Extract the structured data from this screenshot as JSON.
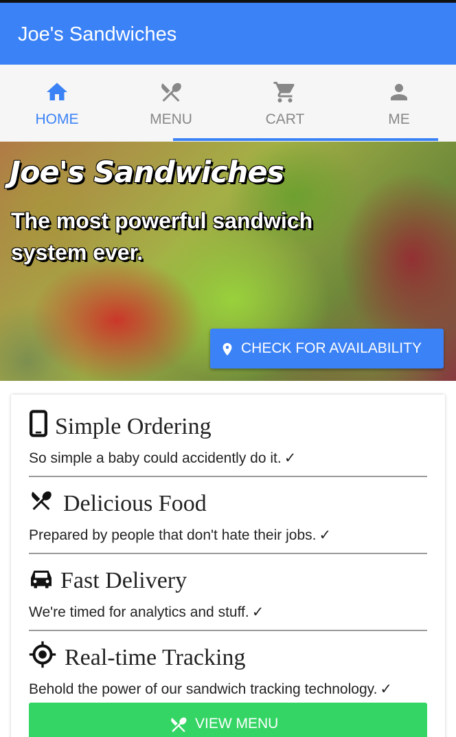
{
  "app_bar": {
    "title": "Joe's Sandwiches"
  },
  "tabs": [
    {
      "label": "HOME",
      "icon": "home-icon",
      "active": true
    },
    {
      "label": "MENU",
      "icon": "utensils-icon",
      "active": false
    },
    {
      "label": "CART",
      "icon": "cart-icon",
      "active": false
    },
    {
      "label": "ME",
      "icon": "person-icon",
      "active": false
    }
  ],
  "hero": {
    "title": "Joe's Sandwiches",
    "subtitle": "The most powerful sandwich system ever.",
    "availability_button": "CHECK FOR AVAILABILITY",
    "availability_icon": "location-pin-icon"
  },
  "features": [
    {
      "title": "Simple Ordering",
      "description": "So simple a baby could accidently do it.",
      "icon": "phone-icon"
    },
    {
      "title": "Delicious Food",
      "description": "Prepared by people that don't hate their jobs.",
      "icon": "utensils-icon"
    },
    {
      "title": "Fast Delivery",
      "description": "We're timed for analytics and stuff.",
      "icon": "car-icon"
    },
    {
      "title": "Real-time Tracking",
      "description": "Behold the power of our sandwich tracking technology.",
      "icon": "crosshair-icon"
    }
  ],
  "check_mark": "✓",
  "view_menu_button": {
    "label": "VIEW MENU",
    "icon": "utensils-icon"
  },
  "colors": {
    "primary": "#3b82f6",
    "inactive_tab": "#888888",
    "success": "#35d565",
    "text": "#222222"
  }
}
